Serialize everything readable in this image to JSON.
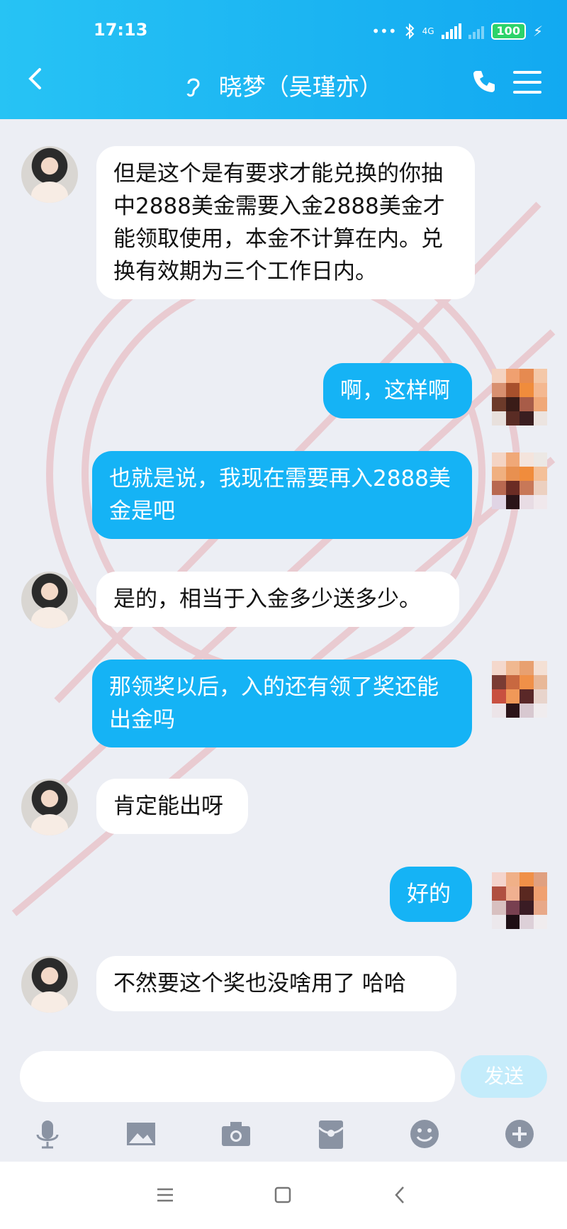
{
  "status": {
    "time": "17:13",
    "network": "4G",
    "battery": "100"
  },
  "header": {
    "contact_name": "晓梦（吴瑾亦）"
  },
  "messages": [
    {
      "side": "in",
      "text": "但是这个是有要求才能兑换的你抽中2888美金需要入金2888美金才能领取使用，本金不计算在内。兑换有效期为三个工作日内。"
    },
    {
      "side": "out",
      "text": "啊，这样啊"
    },
    {
      "side": "out",
      "text": "也就是说，我现在需要再入2888美金是吧"
    },
    {
      "side": "in",
      "text": "是的，相当于入金多少送多少。"
    },
    {
      "side": "out",
      "text": "那领奖以后，入的还有领了奖还能出金吗"
    },
    {
      "side": "in",
      "text": "肯定能出呀"
    },
    {
      "side": "out",
      "text": "好的"
    },
    {
      "side": "in",
      "text": "不然要这个奖也没啥用了 哈哈"
    }
  ],
  "input": {
    "placeholder": "",
    "send_label": "发送"
  },
  "toolbar": {
    "icons": [
      "microphone-icon",
      "image-icon",
      "camera-icon",
      "red-packet-icon",
      "emoji-icon",
      "plus-icon"
    ]
  },
  "colors": {
    "header": "#1fb6f3",
    "outgoing_bubble": "#15b3f5",
    "incoming_bubble": "#ffffff",
    "background": "#eceef4"
  }
}
